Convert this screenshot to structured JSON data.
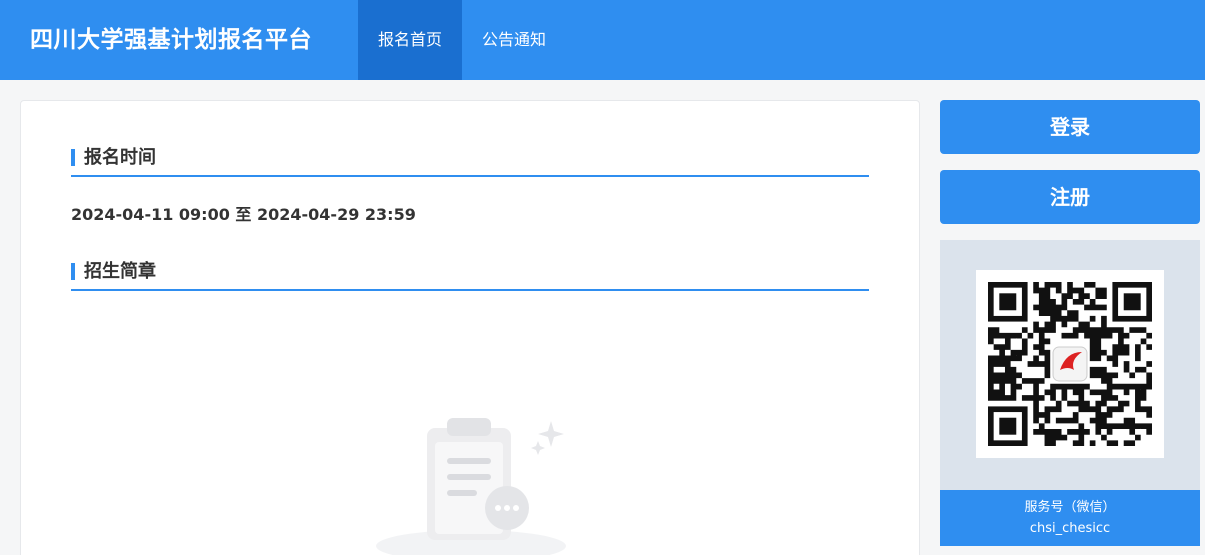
{
  "header": {
    "title": "四川大学强基计划报名平台",
    "nav": [
      {
        "label": "报名首页",
        "active": true
      },
      {
        "label": "公告通知",
        "active": false
      }
    ]
  },
  "main": {
    "registration_time": {
      "heading": "报名时间",
      "value": "2024-04-11 09:00 至 2024-04-29 23:59"
    },
    "brochure": {
      "heading": "招生简章"
    }
  },
  "sidebar": {
    "login_label": "登录",
    "register_label": "注册",
    "qr": {
      "caption_line1": "服务号（微信）",
      "caption_line2": "chsi_chesicc"
    }
  },
  "colors": {
    "primary": "#2f8ef0",
    "nav_active": "#1a6fd0",
    "qr_panel_bg": "#dbe3ec"
  }
}
